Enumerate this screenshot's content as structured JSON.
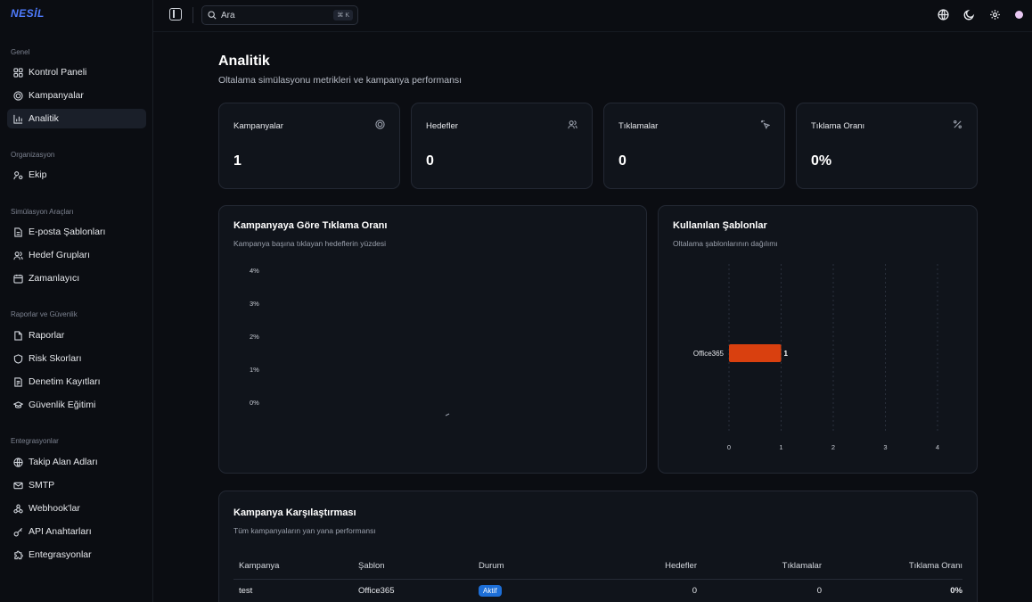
{
  "app": {
    "logo": "NESİL"
  },
  "search": {
    "placeholder": "Ara",
    "shortcut": "⌘ K"
  },
  "sidebar": {
    "sections": [
      {
        "title": "Genel"
      },
      {
        "title": "Organizasyon"
      },
      {
        "title": "Simülasyon Araçları"
      },
      {
        "title": "Raporlar ve Güvenlik"
      },
      {
        "title": "Entegrasyonlar"
      }
    ],
    "items": [
      {
        "label": "Kontrol Paneli",
        "icon": "dashboard-icon"
      },
      {
        "label": "Kampanyalar",
        "icon": "target-icon"
      },
      {
        "label": "Analitik",
        "icon": "chart-icon",
        "active": true
      },
      {
        "label": "Ekip",
        "icon": "team-icon"
      },
      {
        "label": "E-posta Şablonları",
        "icon": "file-icon"
      },
      {
        "label": "Hedef Grupları",
        "icon": "users-icon"
      },
      {
        "label": "Zamanlayıcı",
        "icon": "calendar-icon"
      },
      {
        "label": "Raporlar",
        "icon": "report-icon"
      },
      {
        "label": "Risk Skorları",
        "icon": "shield-icon"
      },
      {
        "label": "Denetim Kayıtları",
        "icon": "audit-icon"
      },
      {
        "label": "Güvenlik Eğitimi",
        "icon": "graduation-icon"
      },
      {
        "label": "Takip Alan Adları",
        "icon": "globe-icon"
      },
      {
        "label": "SMTP",
        "icon": "mail-icon"
      },
      {
        "label": "Webhook'lar",
        "icon": "webhook-icon"
      },
      {
        "label": "API Anahtarları",
        "icon": "key-icon"
      },
      {
        "label": "Entegrasyonlar",
        "icon": "puzzle-icon"
      }
    ]
  },
  "header": {
    "title": "Analitik",
    "subtitle": "Oltalama simülasyonu metrikleri ve kampanya performansı"
  },
  "stats": [
    {
      "label": "Kampanyalar",
      "value": "1",
      "icon": "target-icon"
    },
    {
      "label": "Hedefler",
      "value": "0",
      "icon": "users-icon"
    },
    {
      "label": "Tıklamalar",
      "value": "0",
      "icon": "click-icon"
    },
    {
      "label": "Tıklama Oranı",
      "value": "0%",
      "icon": "percent-icon"
    }
  ],
  "click_rate_card": {
    "title": "Kampanyaya Göre Tıklama Oranı",
    "subtitle": "Kampanya başına tıklayan hedeflerin yüzdesi"
  },
  "templates_card": {
    "title": "Kullanılan Şablonlar",
    "subtitle": "Oltalama şablonlarının dağılımı"
  },
  "chart_data": [
    {
      "type": "bar",
      "title": "Kampanyaya Göre Tıklama Oranı",
      "y_ticks": [
        "4%",
        "3%",
        "2%",
        "1%",
        "0%"
      ],
      "ylim": [
        0,
        4
      ],
      "categories": [],
      "values": [],
      "grid": false
    },
    {
      "type": "bar",
      "orientation": "horizontal",
      "title": "Kullanılan Şablonlar",
      "categories": [
        "Office365"
      ],
      "values": [
        1
      ],
      "xlim": [
        0,
        4
      ],
      "x_ticks": [
        "0",
        "1",
        "2",
        "3",
        "4"
      ],
      "bar_color": "#d9400f",
      "grid": true
    }
  ],
  "comparison": {
    "title": "Kampanya Karşılaştırması",
    "subtitle": "Tüm kampanyaların yan yana performansı",
    "columns": [
      "Kampanya",
      "Şablon",
      "Durum",
      "Hedefler",
      "Tıklamalar",
      "Tıklama Oranı"
    ],
    "rows": [
      {
        "campaign": "test",
        "template": "Office365",
        "status": "Aktif",
        "targets": "0",
        "clicks": "0",
        "rate": "0%"
      }
    ],
    "status_color": "#1d6fd8"
  }
}
